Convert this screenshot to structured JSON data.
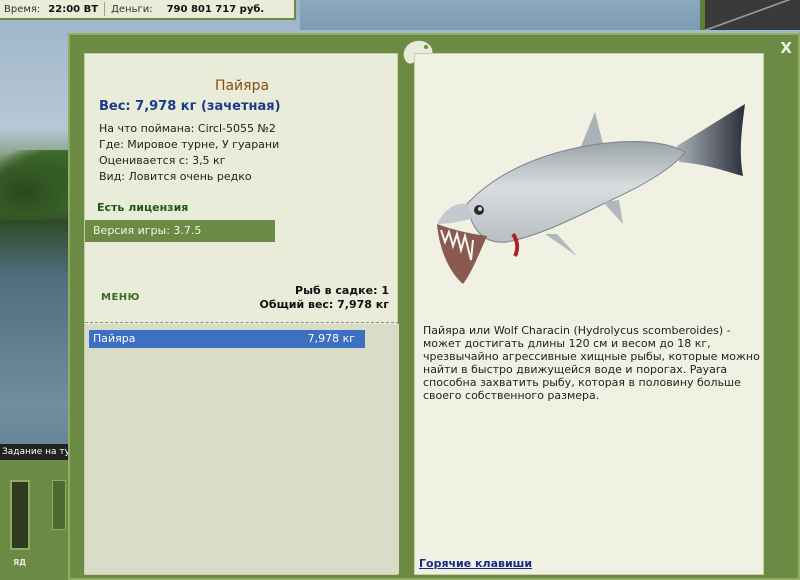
{
  "status": {
    "time_label": "Время:",
    "time_value": "22:00 ВТ",
    "money_label": "Деньги:",
    "money_value": "790 801 717 руб."
  },
  "task_tab": {
    "label": "Задание на тур"
  },
  "bottom_panel": {
    "label": "ЯД"
  },
  "window": {
    "close_label": "X"
  },
  "fish": {
    "name": "Пайяра",
    "weight": "Вес: 7,978 кг (зачетная)",
    "caught_with": "На что поймана: Circl-5055 №2",
    "where": "Где: Мировое турне, У гуарани",
    "valued_from": "Оценивается с: 3,5 кг",
    "type": "Вид: Ловится очень редко"
  },
  "license": "Есть лицензия",
  "version": "Версия игры: 3.7.5",
  "menu": "МЕНЮ",
  "stats": {
    "fish_count": "Рыб в садке: 1",
    "total_weight": "Общий вес: 7,978 кг"
  },
  "catch_list": [
    {
      "name": "Пайяра",
      "weight": "7,978 кг"
    }
  ],
  "description": "Пайяра или Wolf Characin (Hydrolycus scomberoides) - может достигать длины 120 см и весом до 18 кг, чрезвычайно агрессивные хищные рыбы, которые можно найти в быстро движущейся воде и порогах. Payara способна захватить рыбу, которая в половину больше своего собственного размера.",
  "hotkeys": "Горячие клавиши",
  "colors": {
    "panel_green": "#6b8a43",
    "list_selected": "#3d6fc3",
    "fish_name": "#8a4a0e",
    "weight_blue": "#1a3a8a"
  }
}
